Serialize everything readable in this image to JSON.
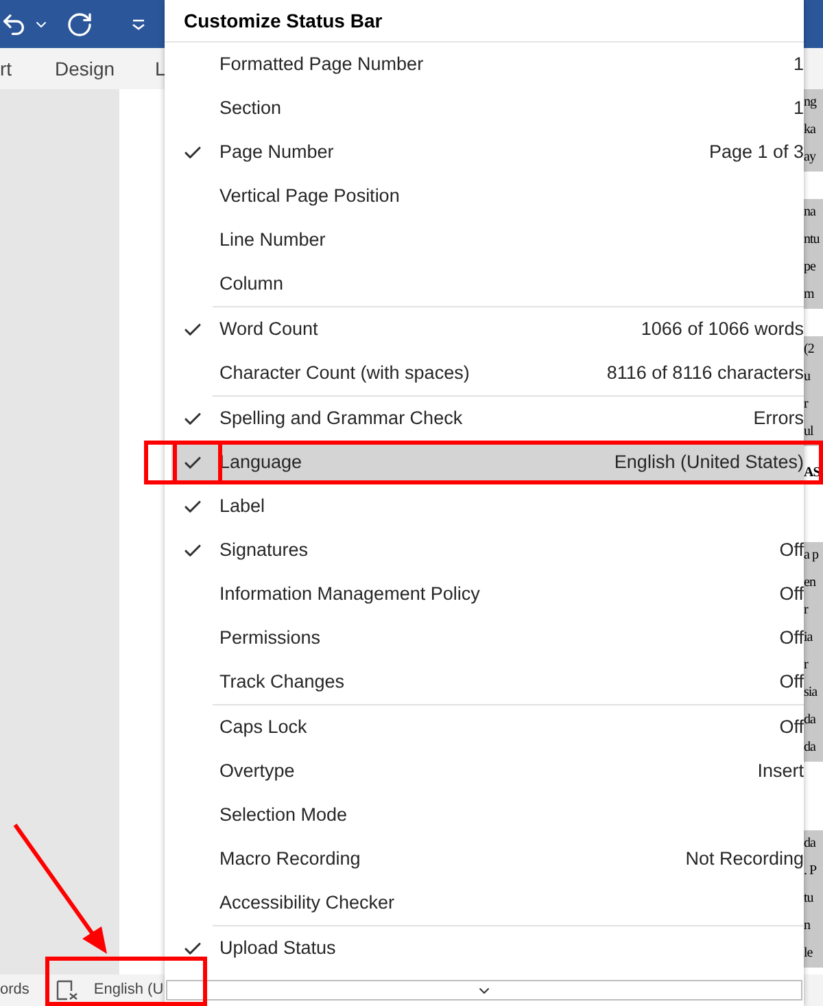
{
  "app": {
    "ribbon_tabs": [
      "rt",
      "Design",
      "L"
    ],
    "document_fragments": [
      {
        "highlighted": true,
        "bold": false,
        "lines": [
          "ng",
          "ka",
          "ay"
        ]
      },
      {
        "highlighted": true,
        "bold": false,
        "lines": [
          "na",
          "ntu",
          "pe",
          "m"
        ]
      },
      {
        "highlighted": true,
        "bold": false,
        "lines": [
          "(2",
          "u",
          "r",
          "ul"
        ]
      },
      {
        "highlighted": false,
        "bold": true,
        "lines": [
          "AS"
        ]
      },
      {
        "highlighted": true,
        "bold": false,
        "lines": [
          "a p",
          "en",
          "r",
          "ia",
          "r",
          "sia",
          "da",
          "da"
        ]
      },
      {
        "highlighted": true,
        "bold": false,
        "lines": [
          "da",
          ". P",
          "tu",
          "n",
          "le"
        ]
      }
    ],
    "status_bar": {
      "word_count": "ords",
      "language": "English (U"
    }
  },
  "menu": {
    "title": "Customize Status Bar",
    "groups": [
      {
        "items": [
          {
            "label": "Formatted Page Number",
            "value": "1",
            "checked": false,
            "selected": false
          },
          {
            "label": "Section",
            "value": "1",
            "checked": false,
            "selected": false
          },
          {
            "label": "Page Number",
            "value": "Page 1 of 3",
            "checked": true,
            "selected": false
          },
          {
            "label": "Vertical Page Position",
            "checked": false,
            "selected": false
          },
          {
            "label": "Line Number",
            "checked": false,
            "selected": false
          },
          {
            "label": "Column",
            "checked": false,
            "selected": false
          }
        ]
      },
      {
        "items": [
          {
            "label": "Word Count",
            "value": "1066 of 1066 words",
            "checked": true,
            "selected": false
          },
          {
            "label": "Character Count (with spaces)",
            "value": "8116 of 8116 characters",
            "checked": false,
            "selected": false
          }
        ]
      },
      {
        "items": [
          {
            "label": "Spelling and Grammar Check",
            "value": "Errors",
            "checked": true,
            "selected": false
          },
          {
            "label": "Language",
            "value": "English (United States)",
            "checked": true,
            "selected": true
          },
          {
            "label": "Label",
            "checked": true,
            "selected": false
          },
          {
            "label": "Signatures",
            "value": "Off",
            "checked": true,
            "selected": false
          },
          {
            "label": "Information Management Policy",
            "value": "Off",
            "checked": false,
            "selected": false
          },
          {
            "label": "Permissions",
            "value": "Off",
            "checked": false,
            "selected": false
          },
          {
            "label": "Track Changes",
            "value": "Off",
            "checked": false,
            "selected": false
          }
        ]
      },
      {
        "items": [
          {
            "label": "Caps Lock",
            "value": "Off",
            "checked": false,
            "selected": false
          },
          {
            "label": "Overtype",
            "value": "Insert",
            "checked": false,
            "selected": false
          },
          {
            "label": "Selection Mode",
            "checked": false,
            "selected": false
          },
          {
            "label": "Macro Recording",
            "value": "Not Recording",
            "checked": false,
            "selected": false
          },
          {
            "label": "Accessibility Checker",
            "checked": false,
            "selected": false
          }
        ]
      },
      {
        "items": [
          {
            "label": "Upload Status",
            "checked": true,
            "selected": false
          }
        ]
      }
    ]
  }
}
